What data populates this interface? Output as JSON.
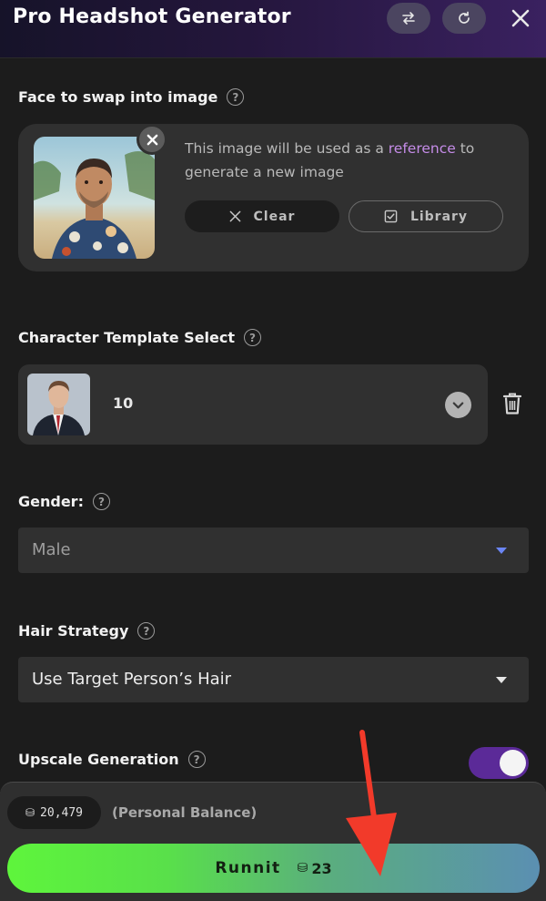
{
  "header": {
    "title": "Pro Headshot Generator"
  },
  "face_section": {
    "label": "Face to swap into image",
    "help": "?",
    "desc_before": "This image will be used as a ",
    "desc_link": "reference",
    "desc_after": " to generate a new image",
    "clear_label": "Clear",
    "library_label": "Library"
  },
  "template_section": {
    "label": "Character Template Select",
    "help": "?",
    "value": "10"
  },
  "gender_section": {
    "label": "Gender:",
    "help": "?",
    "value": "Male"
  },
  "hair_section": {
    "label": "Hair Strategy",
    "help": "?",
    "value": "Use Target Person’s Hair"
  },
  "upscale_section": {
    "label": "Upscale Generation",
    "help": "?",
    "enabled": true
  },
  "footer": {
    "balance_icon": "⛁",
    "balance_value": "20,479",
    "balance_label": "(Personal Balance)",
    "run_label": "Runnit",
    "cost_icon": "⛁",
    "cost_value": "23"
  },
  "colors": {
    "accent_purple": "#5b2a98",
    "link_pink": "#c58ce8",
    "gender_caret": "#6b86f5",
    "annotation_arrow": "#f23a2a"
  },
  "icons": [
    "swap-icon",
    "refresh-icon",
    "close-icon",
    "clear-x-icon",
    "checkbox-icon",
    "chevron-down-icon",
    "trash-icon",
    "coin-icon",
    "arrow-annotation"
  ]
}
